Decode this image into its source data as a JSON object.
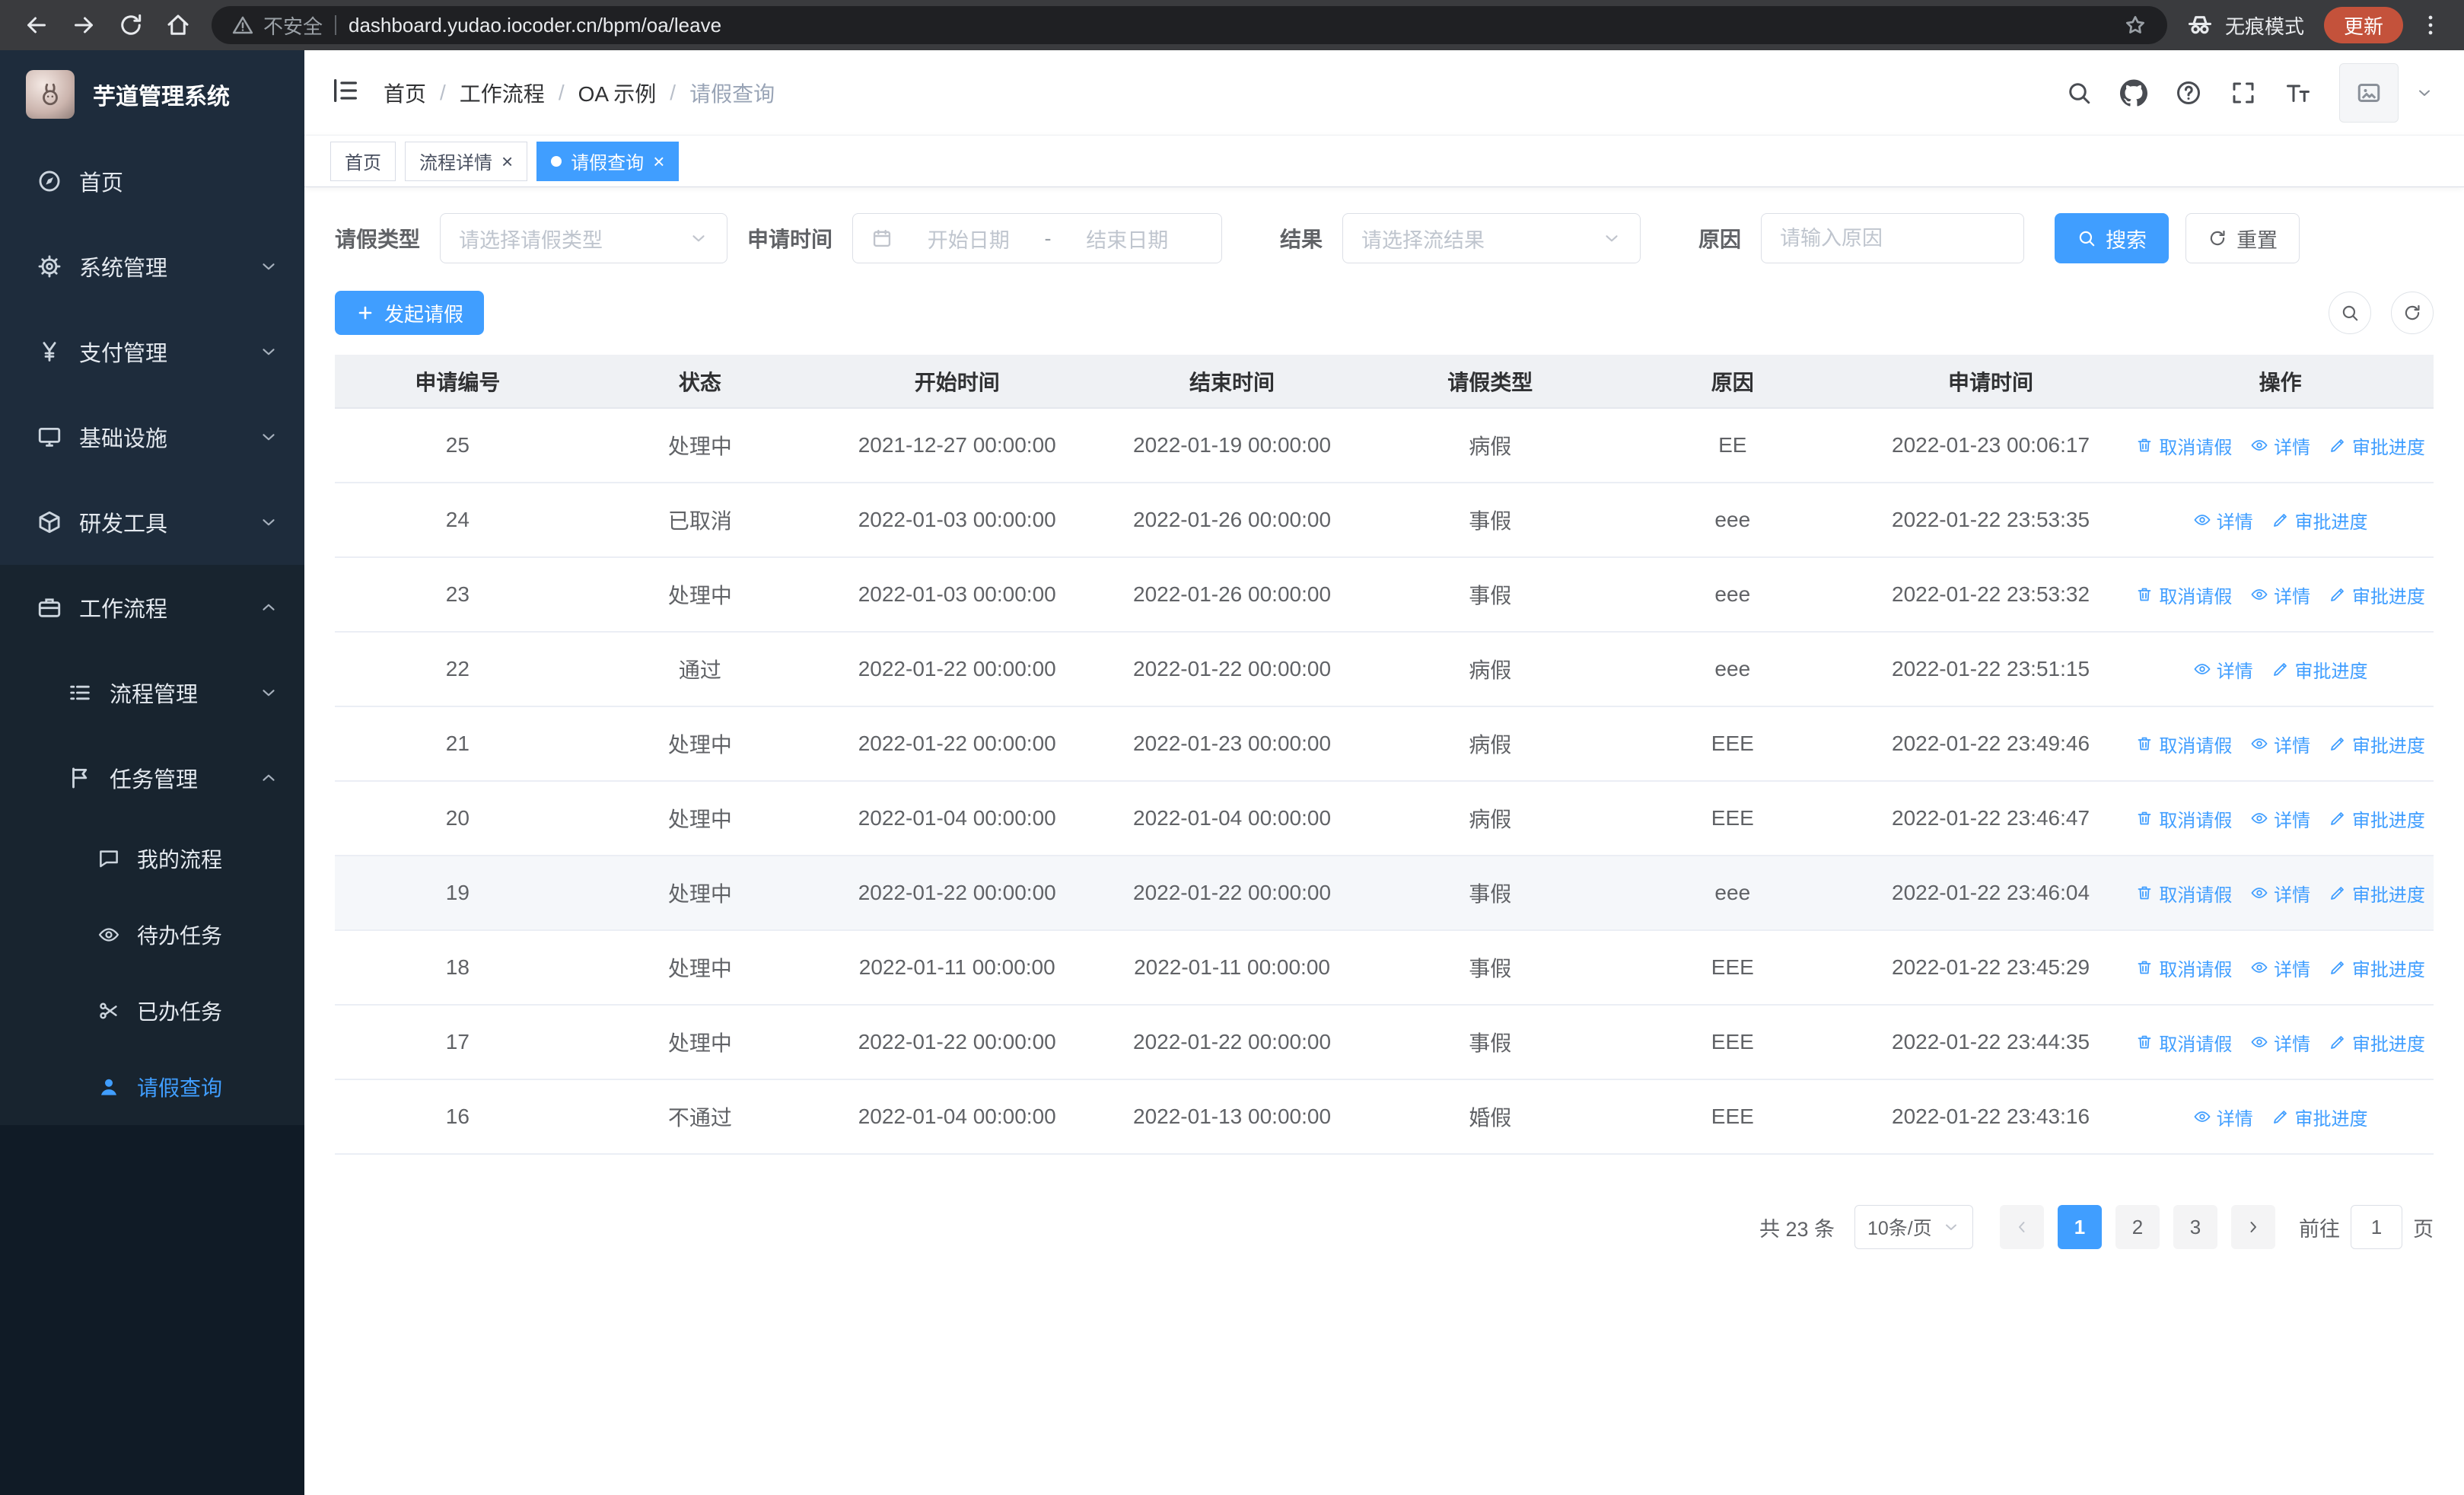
{
  "browser": {
    "security_label": "不安全",
    "url": "dashboard.yudao.iocoder.cn/bpm/oa/leave",
    "incognito_label": "无痕模式",
    "update_label": "更新"
  },
  "sidebar": {
    "logo_title": "芋道管理系统",
    "menu": {
      "home": "首页",
      "system": "系统管理",
      "payment": "支付管理",
      "infra": "基础设施",
      "devtools": "研发工具",
      "workflow": "工作流程",
      "process_mgmt": "流程管理",
      "task_mgmt": "任务管理",
      "my_process": "我的流程",
      "todo_tasks": "待办任务",
      "done_tasks": "已办任务",
      "leave_query": "请假查询"
    }
  },
  "header": {
    "breadcrumb": [
      "首页",
      "工作流程",
      "OA 示例",
      "请假查询"
    ],
    "separator": "/"
  },
  "tabs": [
    {
      "label": "首页"
    },
    {
      "label": "流程详情"
    },
    {
      "label": "请假查询"
    }
  ],
  "icons": {
    "close_glyph": "×"
  },
  "filters": {
    "leave_type_label": "请假类型",
    "leave_type_placeholder": "请选择请假类型",
    "apply_time_label": "申请时间",
    "start_date_placeholder": "开始日期",
    "date_separator": "-",
    "end_date_placeholder": "结束日期",
    "result_label": "结果",
    "result_placeholder": "请选择流结果",
    "reason_label": "原因",
    "reason_placeholder": "请输入原因",
    "search_button": "搜索",
    "reset_button": "重置"
  },
  "toolbar": {
    "create_button": "发起请假"
  },
  "table": {
    "columns": [
      "申请编号",
      "状态",
      "开始时间",
      "结束时间",
      "请假类型",
      "原因",
      "申请时间",
      "操作"
    ],
    "action_labels": {
      "cancel": "取消请假",
      "detail": "详情",
      "progress": "审批进度"
    },
    "rows": [
      {
        "id": "25",
        "status": "处理中",
        "start": "2021-12-27 00:00:00",
        "end": "2022-01-19 00:00:00",
        "type": "病假",
        "reason": "EE",
        "applied": "2022-01-23 00:06:17"
      },
      {
        "id": "24",
        "status": "已取消",
        "start": "2022-01-03 00:00:00",
        "end": "2022-01-26 00:00:00",
        "type": "事假",
        "reason": "eee",
        "applied": "2022-01-22 23:53:35"
      },
      {
        "id": "23",
        "status": "处理中",
        "start": "2022-01-03 00:00:00",
        "end": "2022-01-26 00:00:00",
        "type": "事假",
        "reason": "eee",
        "applied": "2022-01-22 23:53:32"
      },
      {
        "id": "22",
        "status": "通过",
        "start": "2022-01-22 00:00:00",
        "end": "2022-01-22 00:00:00",
        "type": "病假",
        "reason": "eee",
        "applied": "2022-01-22 23:51:15"
      },
      {
        "id": "21",
        "status": "处理中",
        "start": "2022-01-22 00:00:00",
        "end": "2022-01-23 00:00:00",
        "type": "病假",
        "reason": "EEE",
        "applied": "2022-01-22 23:49:46"
      },
      {
        "id": "20",
        "status": "处理中",
        "start": "2022-01-04 00:00:00",
        "end": "2022-01-04 00:00:00",
        "type": "病假",
        "reason": "EEE",
        "applied": "2022-01-22 23:46:47"
      },
      {
        "id": "19",
        "status": "处理中",
        "start": "2022-01-22 00:00:00",
        "end": "2022-01-22 00:00:00",
        "type": "事假",
        "reason": "eee",
        "applied": "2022-01-22 23:46:04"
      },
      {
        "id": "18",
        "status": "处理中",
        "start": "2022-01-11 00:00:00",
        "end": "2022-01-11 00:00:00",
        "type": "事假",
        "reason": "EEE",
        "applied": "2022-01-22 23:45:29"
      },
      {
        "id": "17",
        "status": "处理中",
        "start": "2022-01-22 00:00:00",
        "end": "2022-01-22 00:00:00",
        "type": "事假",
        "reason": "EEE",
        "applied": "2022-01-22 23:44:35"
      },
      {
        "id": "16",
        "status": "不通过",
        "start": "2022-01-04 00:00:00",
        "end": "2022-01-13 00:00:00",
        "type": "婚假",
        "reason": "EEE",
        "applied": "2022-01-22 23:43:16"
      }
    ]
  },
  "pagination": {
    "total_text": "共 23 条",
    "page_size": "10条/页",
    "pages": [
      "1",
      "2",
      "3"
    ],
    "goto_label": "前往",
    "goto_value": "1",
    "page_unit": "页"
  },
  "colors": {
    "accent": "#409eff",
    "sidebar_bg": "#1e2c3c",
    "table_header_bg": "#eff1f4"
  }
}
